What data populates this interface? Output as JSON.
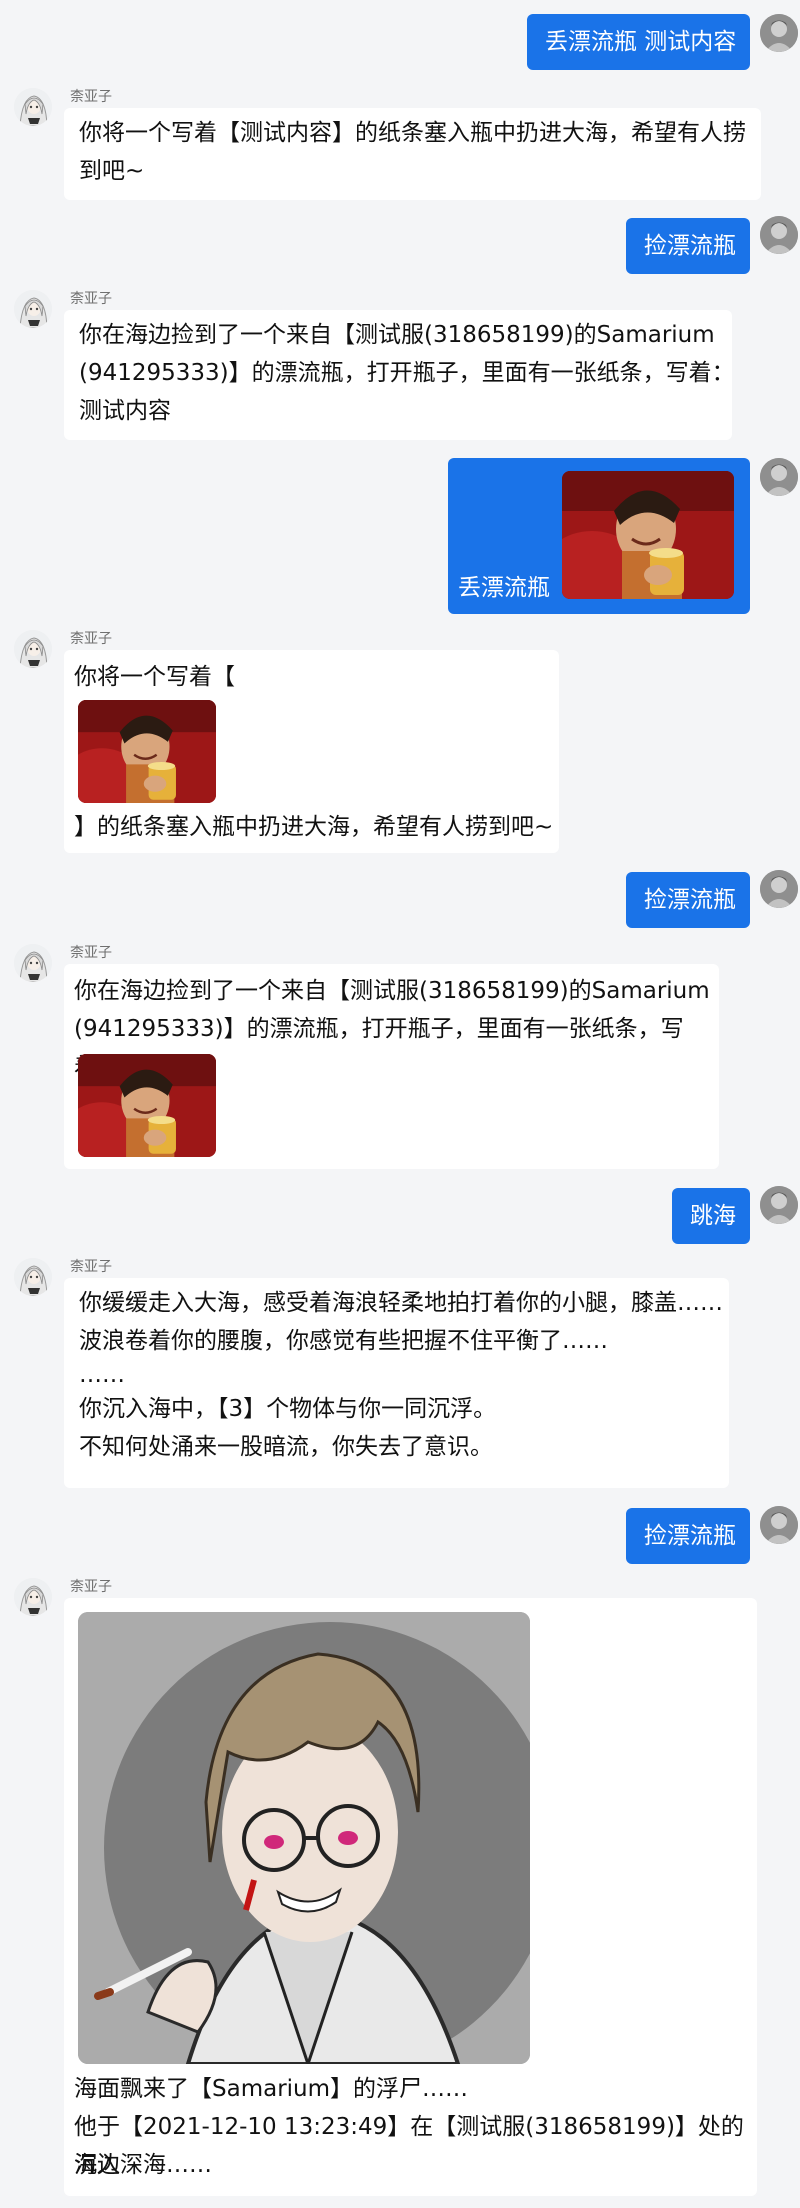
{
  "bot_name": "柰亚子",
  "user_msgs": {
    "m1": "丢漂流瓶 测试内容",
    "m2": "捡漂流瓶",
    "m3": "丢漂流瓶",
    "m4": "捡漂流瓶",
    "m5": "跳海",
    "m6": "捡漂流瓶"
  },
  "bot_msgs": {
    "r1": [
      "你将一个写着【测试内容】的纸条塞入瓶中扔进大海，希望有人捞",
      "到吧~"
    ],
    "r2": [
      "你在海边捡到了一个来自【测试服(318658199)的Samarium",
      "(941295333)】的漂流瓶，打开瓶子，里面有一张纸条，写着：",
      "测试内容"
    ],
    "r3": {
      "before": "你将一个写着【",
      "after": "】的纸条塞入瓶中扔进大海，希望有人捞到吧~"
    },
    "r4": [
      "你在海边捡到了一个来自【测试服(318658199)的Samarium",
      "(941295333)】的漂流瓶，打开瓶子，里面有一张纸条，写着："
    ],
    "r5": [
      "你缓缓走入大海，感受着海浪轻柔地拍打着你的小腿，膝盖……",
      "波浪卷着你的腰腹，你感觉有些把握不住平衡了……",
      "……",
      "你沉入海中，【3】个物体与你一同沉浮。",
      "不知何处涌来一股暗流，你失去了意识。"
    ],
    "r6": [
      "海面飘来了【Samarium】的浮尸……",
      "他于【2021-12-10 13:23:49】在【测试服(318658199)】处的海边",
      "沉入深海……"
    ]
  },
  "colors": {
    "user_bubble": "#1a73e8",
    "bot_bubble": "#ffffff",
    "background": "#f4f5f7"
  },
  "icons": {
    "user_avatar": "user-avatar-icon",
    "bot_avatar": "anime-girl-avatar-icon"
  }
}
